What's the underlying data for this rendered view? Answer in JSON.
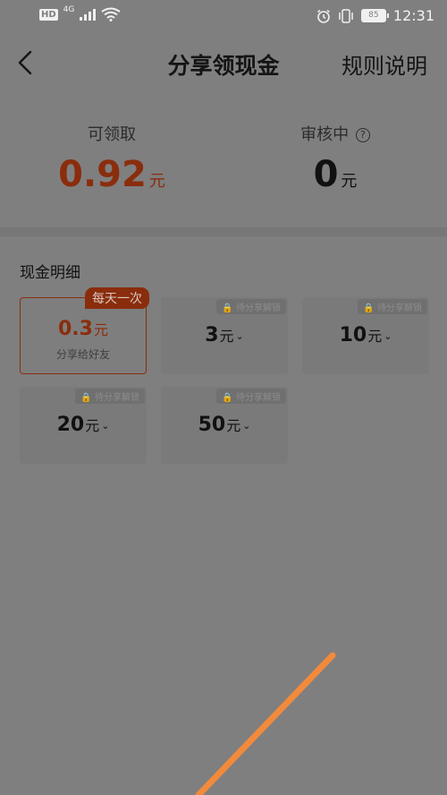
{
  "status_bar": {
    "hd": "HD",
    "network": "4G",
    "battery": "85",
    "time": "12:31"
  },
  "nav": {
    "title": "分享领现金",
    "rules": "规则说明"
  },
  "summary": {
    "available_label": "可领取",
    "available_value": "0.92",
    "available_unit": "元",
    "review_label": "审核中",
    "review_help": "?",
    "review_value": "0",
    "review_unit": "元"
  },
  "cash_detail": {
    "title": "现金明细",
    "cards": [
      {
        "amount": "0.3",
        "unit": "元",
        "tag": "每天一次",
        "subtitle": "分享给好友"
      },
      {
        "amount": "3",
        "unit": "元",
        "tag": "待分享解锁"
      },
      {
        "amount": "10",
        "unit": "元",
        "tag": "待分享解锁"
      },
      {
        "amount": "20",
        "unit": "元",
        "tag": "待分享解锁"
      },
      {
        "amount": "50",
        "unit": "元",
        "tag": "待分享解锁"
      }
    ]
  },
  "colors": {
    "accent": "#8a2d0d",
    "overlay_line": "#f28a3c"
  }
}
